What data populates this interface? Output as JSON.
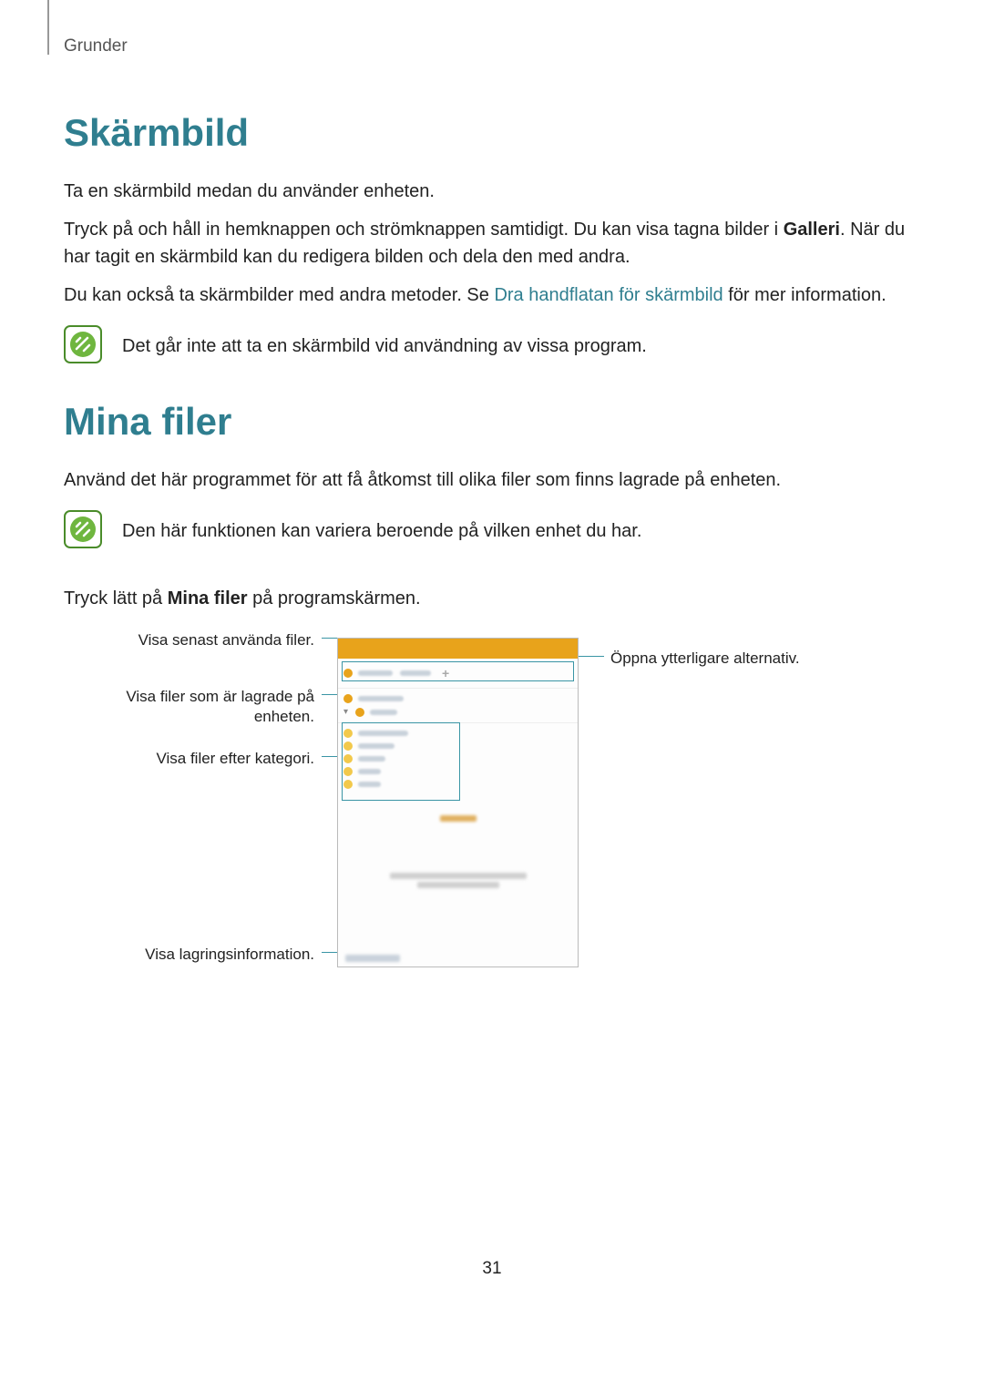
{
  "breadcrumb": "Grunder",
  "section1": {
    "title": "Skärmbild",
    "p1": "Ta en skärmbild medan du använder enheten.",
    "p2a": "Tryck på och håll in hemknappen och strömknappen samtidigt. Du kan visa tagna bilder i ",
    "p2b_bold": "Galleri",
    "p2c": ". När du har tagit en skärmbild kan du redigera bilden och dela den med andra.",
    "p3a": "Du kan också ta skärmbilder med andra metoder. Se ",
    "p3b_link": "Dra handflatan för skärmbild",
    "p3c": " för mer information.",
    "note": "Det går inte att ta en skärmbild vid användning av vissa program."
  },
  "section2": {
    "title": "Mina filer",
    "p1": "Använd det här programmet för att få åtkomst till olika filer som finns lagrade på enheten.",
    "note": "Den här funktionen kan variera beroende på vilken enhet du har.",
    "p2a": "Tryck lätt på ",
    "p2b_bold": "Mina filer",
    "p2c": " på programskärmen."
  },
  "callouts": {
    "recent": "Visa senast använda filer.",
    "stored": "Visa filer som är lagrade på\nenheten.",
    "category": "Visa filer efter kategori.",
    "storage": "Visa lagringsinformation.",
    "options": "Öppna ytterligare alternativ."
  },
  "plus": "+",
  "page_number": "31"
}
